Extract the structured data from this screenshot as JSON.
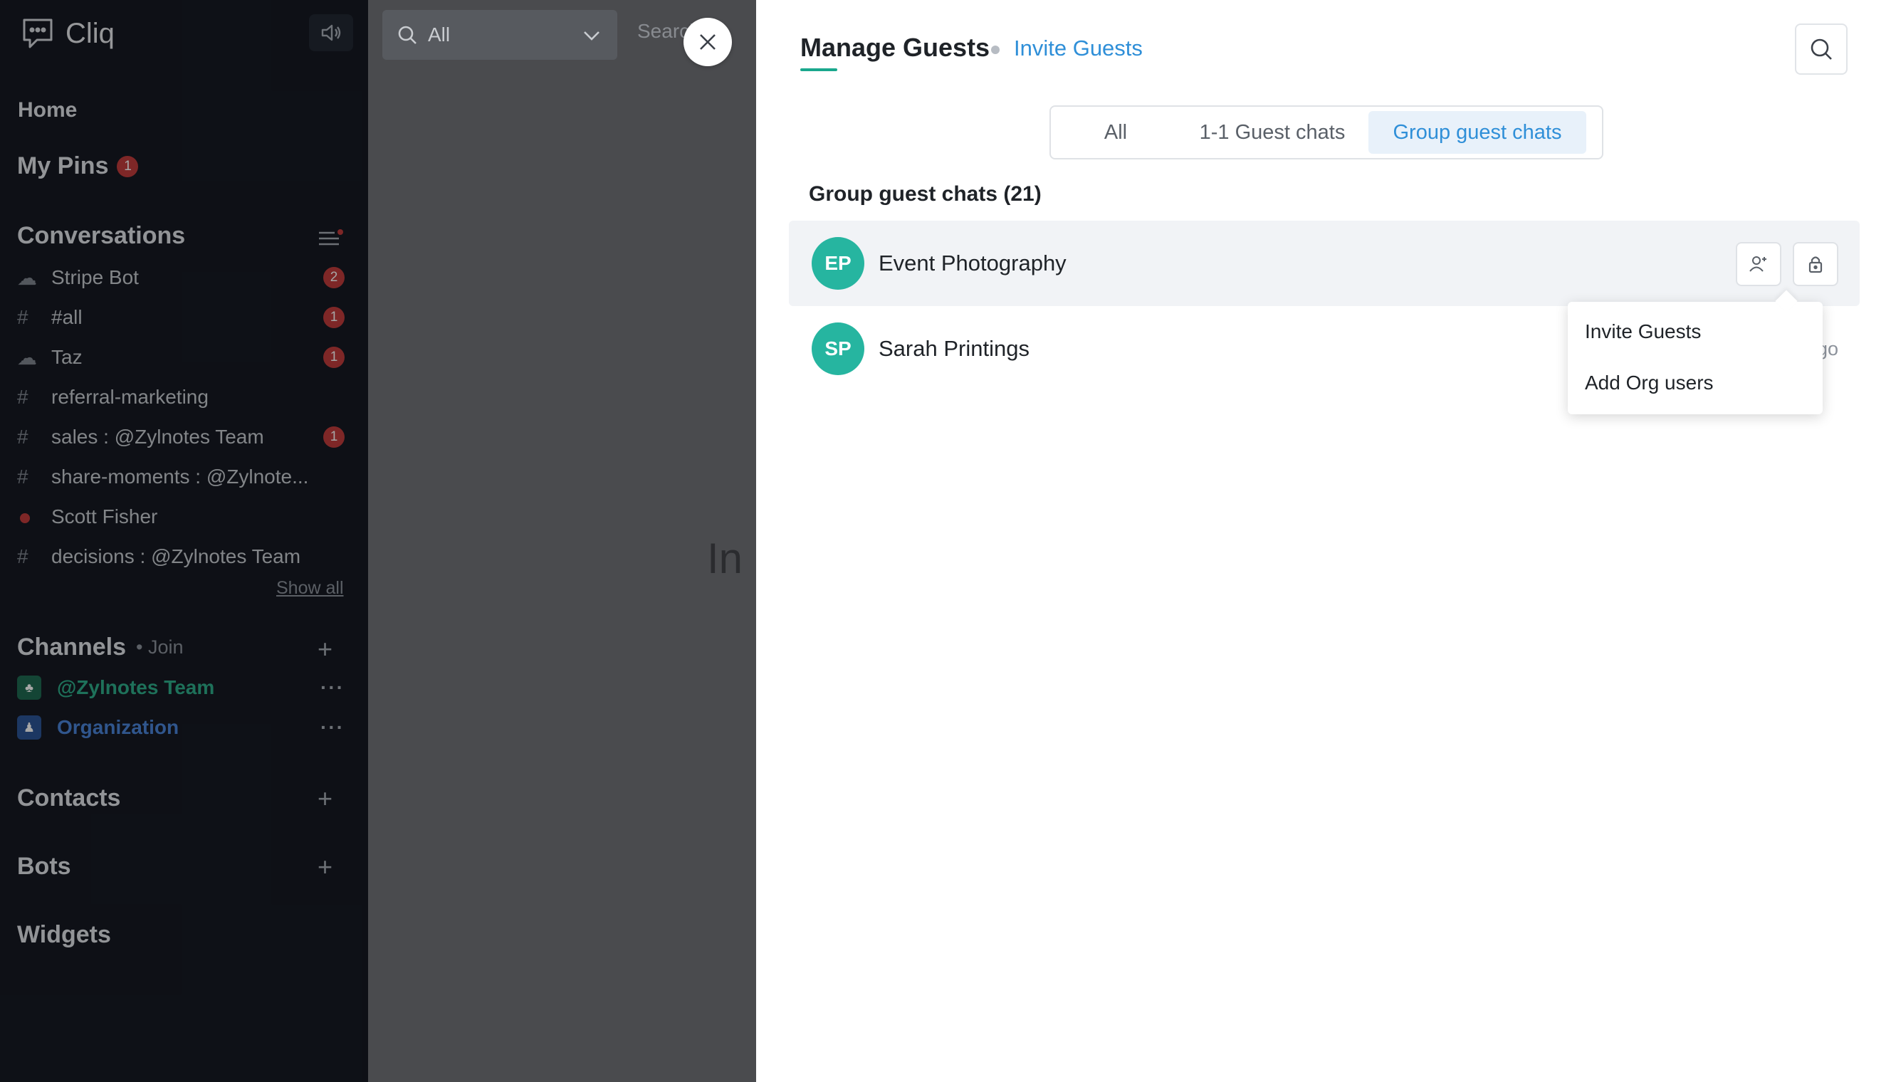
{
  "sidebar": {
    "brand": "Cliq",
    "home": "Home",
    "pins": {
      "label": "My Pins",
      "count": "1"
    },
    "conversations": {
      "title": "Conversations",
      "items": [
        {
          "name": "Stripe Bot",
          "icon": "bot-icon",
          "badge": "2"
        },
        {
          "name": "#all",
          "icon": "hash-icon",
          "badge": "1"
        },
        {
          "name": "Taz",
          "icon": "bot-icon",
          "badge": "1"
        },
        {
          "name": "referral-marketing",
          "icon": "hash-icon",
          "badge": ""
        },
        {
          "name": "sales : @Zylnotes Team",
          "icon": "hash-icon",
          "badge": "1"
        },
        {
          "name": "share-moments : @Zylnote...",
          "icon": "hash-icon",
          "badge": ""
        },
        {
          "name": "Scott Fisher",
          "icon": "status-dot-icon",
          "badge": ""
        },
        {
          "name": "decisions : @Zylnotes Team",
          "icon": "hash-icon",
          "badge": ""
        }
      ],
      "show_all": "Show all"
    },
    "channels": {
      "title": "Channels",
      "join": "• Join",
      "items": [
        {
          "name": "@Zylnotes Team",
          "color": "#2a8a6a"
        },
        {
          "name": "Organization",
          "color": "#3b6fc4"
        }
      ]
    },
    "contacts": "Contacts",
    "bots": "Bots",
    "widgets": "Widgets"
  },
  "middle": {
    "filter_value": "All",
    "search_placeholder": "Search",
    "background_text": "In"
  },
  "panel": {
    "title": "Manage Guests",
    "invite_link": "Invite Guests",
    "tabs": [
      {
        "label": "All",
        "active": false
      },
      {
        "label": "1-1 Guest chats",
        "active": false
      },
      {
        "label": "Group guest chats",
        "active": true
      }
    ],
    "list_heading": "Group guest chats (21)",
    "rows": [
      {
        "initials": "EP",
        "name": "Event Photography",
        "time": ""
      },
      {
        "initials": "SP",
        "name": "Sarah Printings",
        "time": "days ago"
      }
    ],
    "dropdown": {
      "items": [
        "Invite Guests",
        "Add Org users"
      ]
    }
  },
  "colors": {
    "accent": "#2f8fd8",
    "avatar": "#26b5a0",
    "badge": "#c23c3c",
    "sidebar_bg": "#161a23"
  }
}
